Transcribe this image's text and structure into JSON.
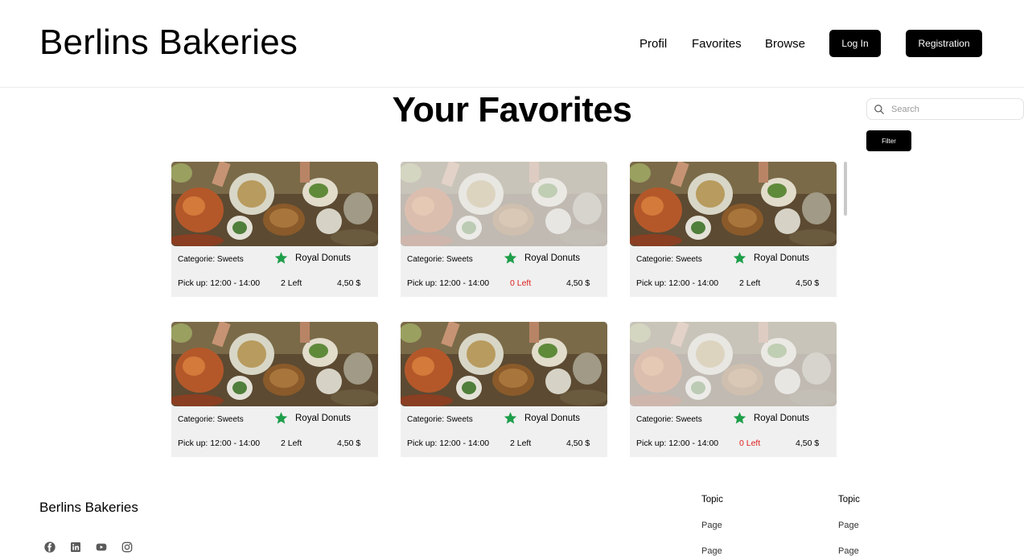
{
  "header": {
    "brand": "Berlins Bakeries",
    "nav": [
      "Profil",
      "Favorites",
      "Browse"
    ],
    "login_label": "Log In",
    "registration_label": "Registration"
  },
  "main": {
    "title": "Your Favorites",
    "search_placeholder": "Search",
    "filter_label": "Filter"
  },
  "cards": [
    {
      "category": "Categorie: Sweets",
      "shop": "Royal Donuts",
      "pickup": "Pick up: 12:00 - 14:00",
      "left": "2 Left",
      "price": "4,50 $",
      "sold_out": false
    },
    {
      "category": "Categorie: Sweets",
      "shop": "Royal Donuts",
      "pickup": "Pick up: 12:00 - 14:00",
      "left": "0 Left",
      "price": "4,50 $",
      "sold_out": true
    },
    {
      "category": "Categorie: Sweets",
      "shop": "Royal Donuts",
      "pickup": "Pick up: 12:00 - 14:00",
      "left": "2 Left",
      "price": "4,50 $",
      "sold_out": false
    },
    {
      "category": "Categorie: Sweets",
      "shop": "Royal Donuts",
      "pickup": "Pick up: 12:00 - 14:00",
      "left": "2 Left",
      "price": "4,50 $",
      "sold_out": false
    },
    {
      "category": "Categorie: Sweets",
      "shop": "Royal Donuts",
      "pickup": "Pick up: 12:00 - 14:00",
      "left": "2 Left",
      "price": "4,50 $",
      "sold_out": false
    },
    {
      "category": "Categorie: Sweets",
      "shop": "Royal Donuts",
      "pickup": "Pick up: 12:00 - 14:00",
      "left": "0 Left",
      "price": "4,50 $",
      "sold_out": true
    }
  ],
  "footer": {
    "brand": "Berlins Bakeries",
    "social_icons": [
      "facebook-icon",
      "linkedin-icon",
      "youtube-icon",
      "instagram-icon"
    ],
    "columns": [
      {
        "topic": "Topic",
        "pages": [
          "Page",
          "Page"
        ]
      },
      {
        "topic": "Topic",
        "pages": [
          "Page",
          "Page"
        ]
      }
    ]
  },
  "colors": {
    "accent_black": "#000000",
    "star_green": "#1e9e4a",
    "sold_out_red": "#e01f1f",
    "card_bg": "#f0f0f0"
  }
}
